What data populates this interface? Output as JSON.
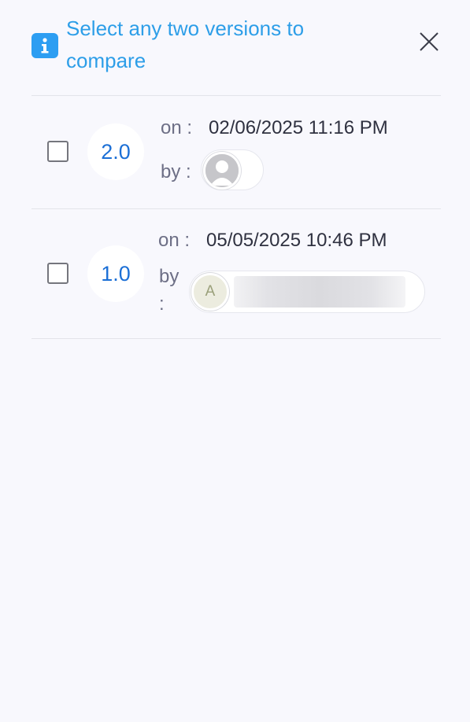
{
  "header": {
    "info_icon": "info-icon",
    "title": "Select any two versions to compare",
    "close_icon": "close-icon"
  },
  "versions": [
    {
      "version": "2.0",
      "on_label": "on :",
      "date": "02/06/2025 11:16 PM",
      "by_label": "by :",
      "author_avatar": "default-user-avatar"
    },
    {
      "version": "1.0",
      "on_label": "on :",
      "date": "05/05/2025 10:46 PM",
      "by_label_line1": "by",
      "by_label_line2": ":",
      "author_initial": "A"
    }
  ],
  "colors": {
    "background": "#f8f8fd",
    "accent": "#2d9ef2",
    "version_text": "#1b6fd6"
  }
}
